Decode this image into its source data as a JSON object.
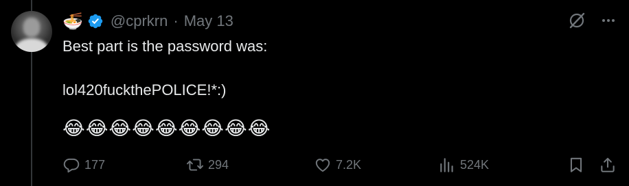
{
  "tweet": {
    "author_emoji": "🍜",
    "handle": "@cprkrn",
    "separator": "·",
    "date": "May 13",
    "line1": "Best part is the password was:",
    "line2": "lol420fuckthePOLICE!*:)",
    "emojis": "😂😂😂😂😂😂😂😂😂"
  },
  "stats": {
    "replies": "177",
    "reposts": "294",
    "likes": "7.2K",
    "views": "524K"
  },
  "icons": {
    "verified": "verified-badge-icon",
    "grok": "grok-icon",
    "more": "more-icon",
    "reply": "reply-icon",
    "repost": "repost-icon",
    "like": "heart-icon",
    "views": "views-icon",
    "bookmark": "bookmark-icon",
    "share": "share-icon"
  },
  "colors": {
    "background": "#000000",
    "text": "#e7e9ea",
    "muted": "#71767b",
    "verified": "#1d9bf0"
  }
}
